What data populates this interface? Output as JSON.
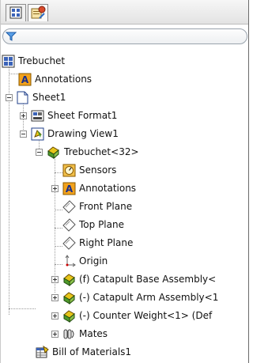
{
  "tabs": [
    {
      "name": "FeatureManager design tree",
      "icon": "feature-tree-icon"
    },
    {
      "name": "Property manager",
      "icon": "property-manager-icon"
    }
  ],
  "filter": {
    "icon": "filter-icon"
  },
  "tree": {
    "root": "Trebuchet",
    "annotations": "Annotations",
    "sheet": "Sheet1",
    "sheet_format": "Sheet Format1",
    "drawing_view": "Drawing View1",
    "model": "Trebuchet<32>",
    "sensors": "Sensors",
    "model_annotations": "Annotations",
    "front_plane": "Front Plane",
    "top_plane": "Top Plane",
    "right_plane": "Right Plane",
    "origin": "Origin",
    "base_assembly": "(f) Catapult Base Assembly<",
    "arm_assembly": "(-) Catapult Arm Assembly<1",
    "counter_weight": "(-) Counter Weight<1> (Def",
    "mates": "Mates",
    "bom": "Bill of Materials1"
  },
  "colors": {
    "annotation": "#d98b00",
    "assembly_yellow": "#e6c51a",
    "assembly_green": "#4f9a2a",
    "sheet_blue": "#2f5fa8"
  }
}
